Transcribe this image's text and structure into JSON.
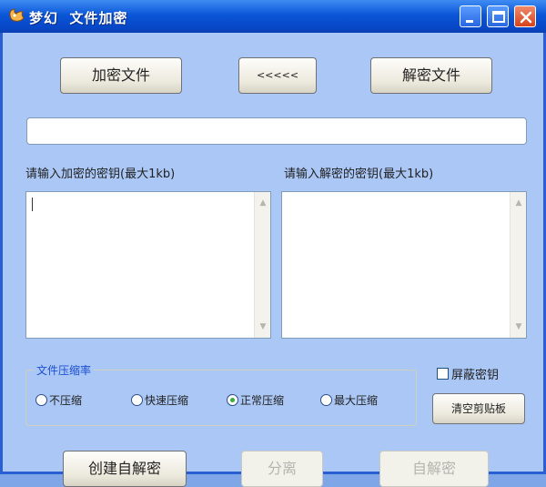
{
  "window": {
    "title": "梦幻  文件加密",
    "colors": {
      "titlebar": "#0a56d8",
      "body": "#aac7f5",
      "close": "#d6421c"
    }
  },
  "toolbar": {
    "encrypt_label": "加密文件",
    "swap_label": "<<<<<",
    "decrypt_label": "解密文件"
  },
  "path_field": {
    "value": ""
  },
  "encrypt_key": {
    "label": "请输入加密的密钥(最大1kb)",
    "value": ""
  },
  "decrypt_key": {
    "label": "请输入解密的密钥(最大1kb)",
    "value": ""
  },
  "compression": {
    "title": "文件压缩率",
    "options": [
      {
        "label": "不压缩",
        "selected": false
      },
      {
        "label": "快速压缩",
        "selected": false
      },
      {
        "label": "正常压缩",
        "selected": true
      },
      {
        "label": "最大压缩",
        "selected": false
      }
    ]
  },
  "hide_key": {
    "label": "屏蔽密钥",
    "checked": false
  },
  "clear_clipboard_label": "清空剪贴板",
  "bottom": {
    "create_self_extract_label": "创建自解密",
    "split_label": "分离",
    "self_decrypt_label": "自解密"
  }
}
